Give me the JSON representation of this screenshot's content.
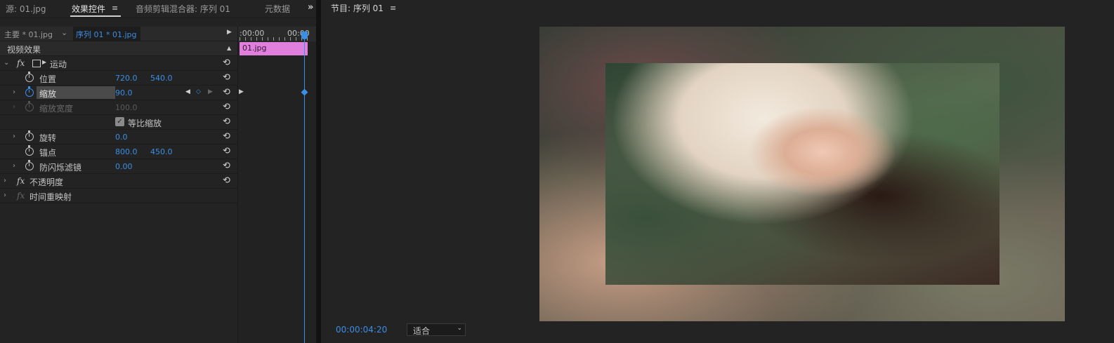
{
  "tabs": {
    "source": "源: 01.jpg",
    "effect_controls": "效果控件",
    "audio_mixer": "音频剪辑混合器: 序列 01",
    "metadata": "元数据",
    "menu_glyph": "≡",
    "overflow": "»"
  },
  "effect_controls": {
    "master": "主要 * 01.jpg",
    "sequence_clip": "序列 01 * 01.jpg",
    "video_effects": "视频效果",
    "motion": "运动",
    "position": {
      "label": "位置",
      "x": "720.0",
      "y": "540.0"
    },
    "scale": {
      "label": "缩放",
      "value": "90.0"
    },
    "scale_width": {
      "label": "缩放宽度",
      "value": "100.0"
    },
    "uniform_scale": "等比缩放",
    "rotation": {
      "label": "旋转",
      "value": "0.0"
    },
    "anchor": {
      "label": "锚点",
      "x": "800.0",
      "y": "450.0"
    },
    "anti_flicker": {
      "label": "防闪烁滤镜",
      "value": "0.00"
    },
    "opacity": "不透明度",
    "time_remap": "时间重映射",
    "fx_label": "fx"
  },
  "mini_timeline": {
    "start": ":00:00",
    "end": "00:00",
    "clip": "01.jpg"
  },
  "program": {
    "title": "节目: 序列 01",
    "timecode": "00:00:04:20",
    "fit": "适合"
  },
  "colors": {
    "accent": "#3a8fe6",
    "clip": "#e07fdc",
    "panel": "#232323"
  }
}
